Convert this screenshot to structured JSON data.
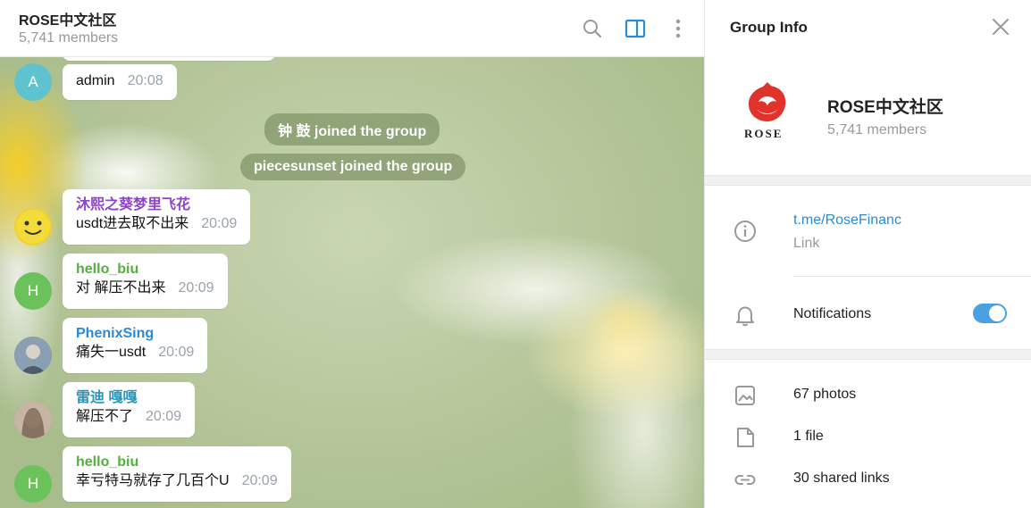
{
  "chat": {
    "title": "ROSE中文社区",
    "members": "5,741 members"
  },
  "messages": [
    {
      "avatar_letter": "A",
      "avatar_color": "#5fc2cf",
      "sender": "",
      "text": "admin",
      "time": "20:08"
    },
    {
      "avatar_letter": "",
      "avatar_color": "#f0d030",
      "sender": "沐熙之葵梦里飞花",
      "sender_color": "#8e44c8",
      "text": "usdt进去取不出来",
      "time": "20:09"
    },
    {
      "avatar_letter": "H",
      "avatar_color": "#6cc25a",
      "sender": "hello_biu",
      "sender_color": "#52b03c",
      "text": "对   解压不出来",
      "time": "20:09"
    },
    {
      "avatar_letter": "",
      "avatar_color": "#6a7f93",
      "sender": "PhenixSing",
      "sender_color": "#2a8ad6",
      "text": "痛失一usdt",
      "time": "20:09"
    },
    {
      "avatar_letter": "",
      "avatar_color": "#b09a88",
      "sender": "雷迪 嘎嘎",
      "sender_color": "#2a96b8",
      "text": "解压不了",
      "time": "20:09"
    },
    {
      "avatar_letter": "H",
      "avatar_color": "#6cc25a",
      "sender": "hello_biu",
      "sender_color": "#52b03c",
      "text": "幸亏特马就存了几百个U",
      "time": "20:09"
    }
  ],
  "service": [
    "钟 鼓 joined the group",
    "piecesunset joined the group"
  ],
  "info": {
    "title": "Group Info",
    "group_name": "ROSE中文社区",
    "members": "5,741 members",
    "logo_text": "ROSE",
    "link": "t.me/RoseFinanc",
    "link_label": "Link",
    "notifications": "Notifications",
    "notifications_on": true,
    "photos": "67 photos",
    "files": "1 file",
    "links": "30 shared links"
  },
  "colors": {
    "accent": "#2a8ad6",
    "toggle": "#4aa0e0"
  }
}
